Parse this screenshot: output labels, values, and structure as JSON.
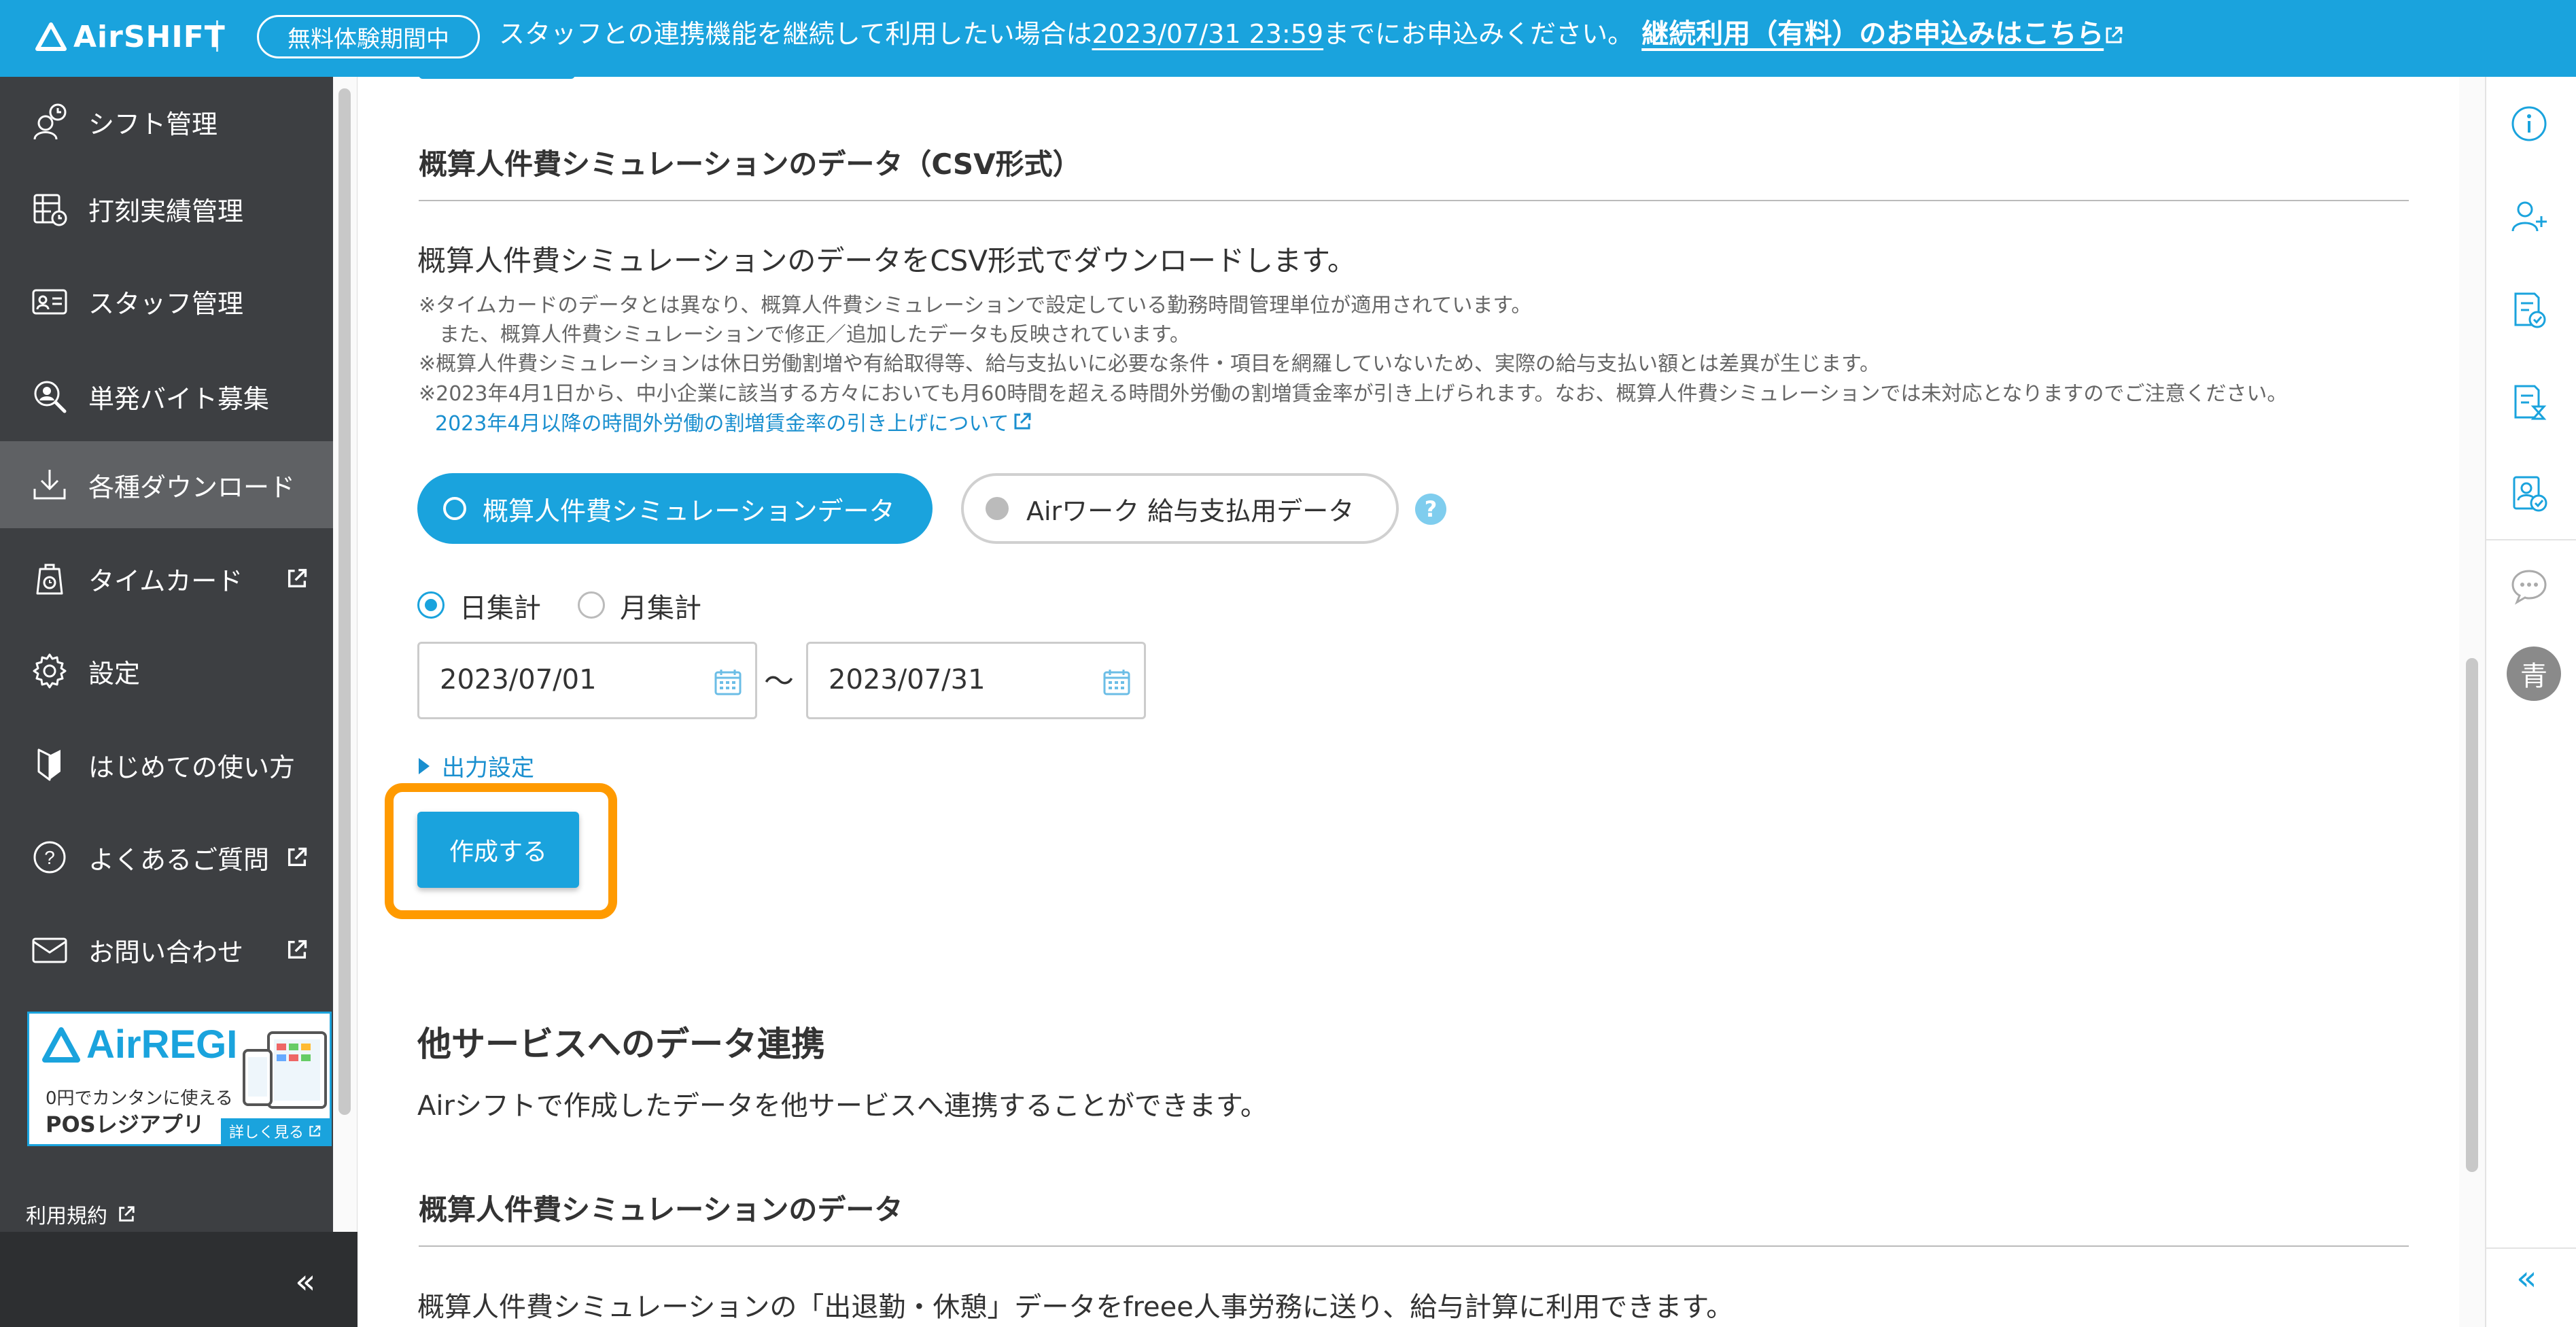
{
  "banner": {
    "brand": "AirSHIFT",
    "trial_badge": "無料体験期間中",
    "notice_pre": "スタッフとの連携機能を継続して利用したい場合は",
    "notice_deadline": "2023/07/31 23:59",
    "notice_post": "までにお申込みください。",
    "cta": "継続利用（有料）のお申込みはこちら"
  },
  "sidebar": {
    "items": [
      {
        "label": "シフト管理",
        "icon": "shift-icon",
        "external": false
      },
      {
        "label": "打刻実績管理",
        "icon": "timesheet-icon",
        "external": false
      },
      {
        "label": "スタッフ管理",
        "icon": "staff-card-icon",
        "external": false
      },
      {
        "label": "単発バイト募集",
        "icon": "recruit-search-icon",
        "external": false
      },
      {
        "label": "各種ダウンロード",
        "icon": "download-icon",
        "external": false,
        "active": true
      },
      {
        "label": "タイムカード",
        "icon": "timecard-icon",
        "external": true
      },
      {
        "label": "設定",
        "icon": "gear-icon",
        "external": false
      },
      {
        "label": "はじめての使い方",
        "icon": "beginner-icon",
        "external": false
      },
      {
        "label": "よくあるご質問",
        "icon": "question-icon",
        "external": true
      },
      {
        "label": "お問い合わせ",
        "icon": "mail-icon",
        "external": true
      }
    ],
    "ad": {
      "brand": "AirREGI",
      "line1": "0円でカンタンに使える",
      "line2": "POSレジアプリ",
      "more": "詳しく見る"
    },
    "terms": "利用規約",
    "collapse": "«"
  },
  "main": {
    "csv_section": {
      "heading": "概算人件費シミュレーションのデータ（CSV形式）",
      "description": "概算人件費シミュレーションのデータをCSV形式でダウンロードします。",
      "notes": [
        "※タイムカードのデータとは異なり、概算人件費シミュレーションで設定している勤務時間管理単位が適用されています。",
        "　また、概算人件費シミュレーションで修正／追加したデータも反映されています。",
        "※概算人件費シミュレーションは休日労働割増や有給取得等、給与支払いに必要な条件・項目を網羅していないため、実際の給与支払い額とは差異が生じます。",
        "※2023年4月1日から、中小企業に該当する方々においても月60時間を超える時間外労働の割増賃金率が引き上げられます。なお、概算人件費シミュレーションでは未対応となりますのでご注意ください。"
      ],
      "link": "2023年4月以降の時間外労働の割増賃金率の引き上げについて",
      "data_types": [
        {
          "label": "概算人件費シミュレーションデータ",
          "selected": true
        },
        {
          "label": "Airワーク 給与支払用データ",
          "selected": false
        }
      ],
      "help": "?",
      "aggregation": [
        {
          "label": "日集計",
          "selected": true
        },
        {
          "label": "月集計",
          "selected": false
        }
      ],
      "date_from": "2023/07/01",
      "date_to": "2023/07/31",
      "range_sep": "〜",
      "output_settings": "出力設定",
      "create_button": "作成する"
    },
    "integration_section": {
      "heading": "他サービスへのデータ連携",
      "description": "Airシフトで作成したデータを他サービスへ連携することができます。",
      "sub_heading": "概算人件費シミュレーションのデータ",
      "sub_description": "概算人件費シミュレーションの「出退勤・休憩」データをfreee人事労務に送り、給与計算に利用できます。"
    }
  },
  "right_rail": {
    "icons": [
      "info-icon",
      "add-user-icon",
      "doc-check-icon",
      "doc-hourglass-icon",
      "staff-check-icon",
      "chat-icon"
    ],
    "avatar": "青",
    "collapse": "«"
  },
  "colors": {
    "brand": "#1aa3dd",
    "sidebar": "#3d3f42",
    "highlight": "#ff9a00"
  }
}
